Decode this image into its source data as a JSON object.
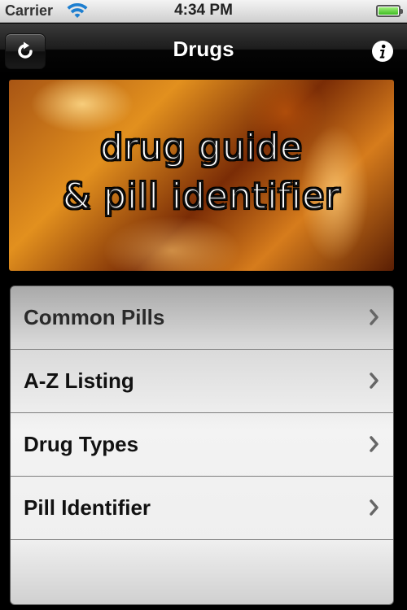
{
  "status_bar": {
    "carrier": "Carrier",
    "time": "4:34 PM",
    "battery_level": 1.0,
    "battery_color": "#3fbb23"
  },
  "nav_bar": {
    "title": "Drugs",
    "left_icon": "refresh-icon",
    "right_icon": "info-icon"
  },
  "banner": {
    "line1": "drug guide",
    "line2": "& pill identifier"
  },
  "menu": {
    "items": [
      {
        "label": "Common Pills",
        "icon": "chevron-right-icon"
      },
      {
        "label": "A-Z Listing",
        "icon": "chevron-right-icon"
      },
      {
        "label": "Drug Types",
        "icon": "chevron-right-icon"
      },
      {
        "label": "Pill Identifier",
        "icon": "chevron-right-icon"
      }
    ]
  }
}
